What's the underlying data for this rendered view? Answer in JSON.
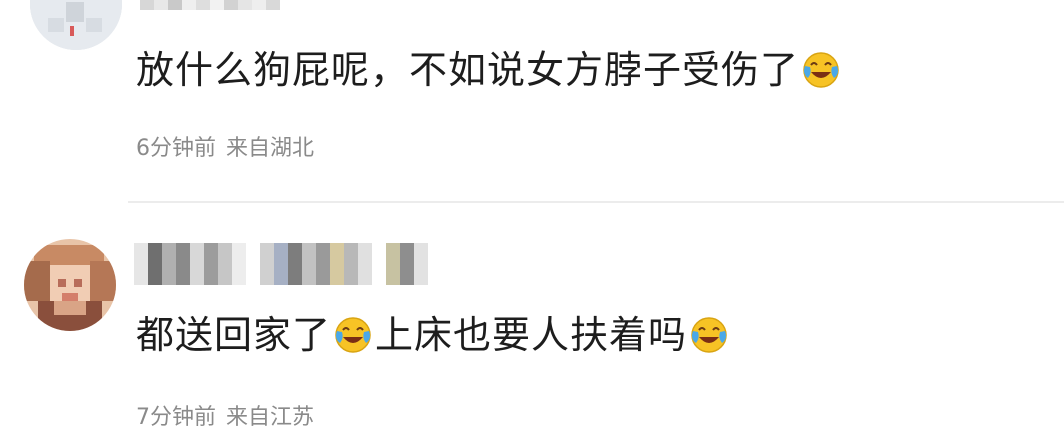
{
  "comments": [
    {
      "text": "放什么狗屁呢，不如说女方脖子受伤了",
      "emoji": "laugh-crying-emoji",
      "time": "6分钟前",
      "location": "来自湖北"
    },
    {
      "text_part1": "都送回家了",
      "text_part2": "上床也要人扶着吗",
      "emoji": "laugh-crying-emoji",
      "time": "7分钟前",
      "location": "来自江苏"
    }
  ],
  "colors": {
    "text": "#1d1d1d",
    "meta": "#8a8a8a",
    "divider": "#ececec",
    "emoji_face": "#f7c325",
    "emoji_tears": "#4aa8e8"
  }
}
